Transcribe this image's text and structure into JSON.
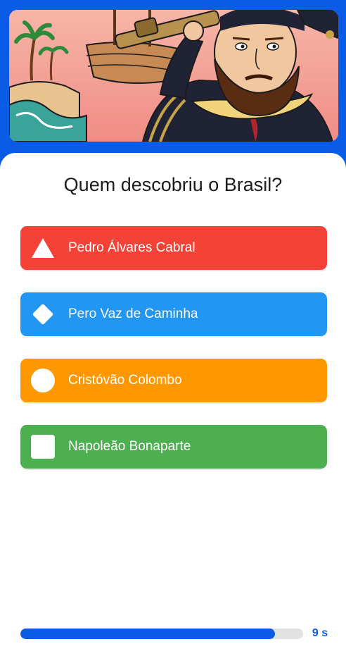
{
  "colors": {
    "background": "#0a5ce6",
    "progress_fill": "#0a5ce6",
    "progress_track": "#e2e2e2",
    "timer_text": "#0a5ce6"
  },
  "question": {
    "text": "Quem descobriu o Brasil?",
    "image_description": "illustration"
  },
  "answers": [
    {
      "label": "Pedro Álvares Cabral",
      "color": "#f44336",
      "icon": "triangle-icon"
    },
    {
      "label": "Pero Vaz de Caminha",
      "color": "#2196f3",
      "icon": "diamond-icon"
    },
    {
      "label": "Cristóvão Colombo",
      "color": "#ff9800",
      "icon": "circle-icon"
    },
    {
      "label": "Napoleão Bonaparte",
      "color": "#4caf50",
      "icon": "square-icon"
    }
  ],
  "timer": {
    "label": "9 s",
    "progress": 0.9
  }
}
